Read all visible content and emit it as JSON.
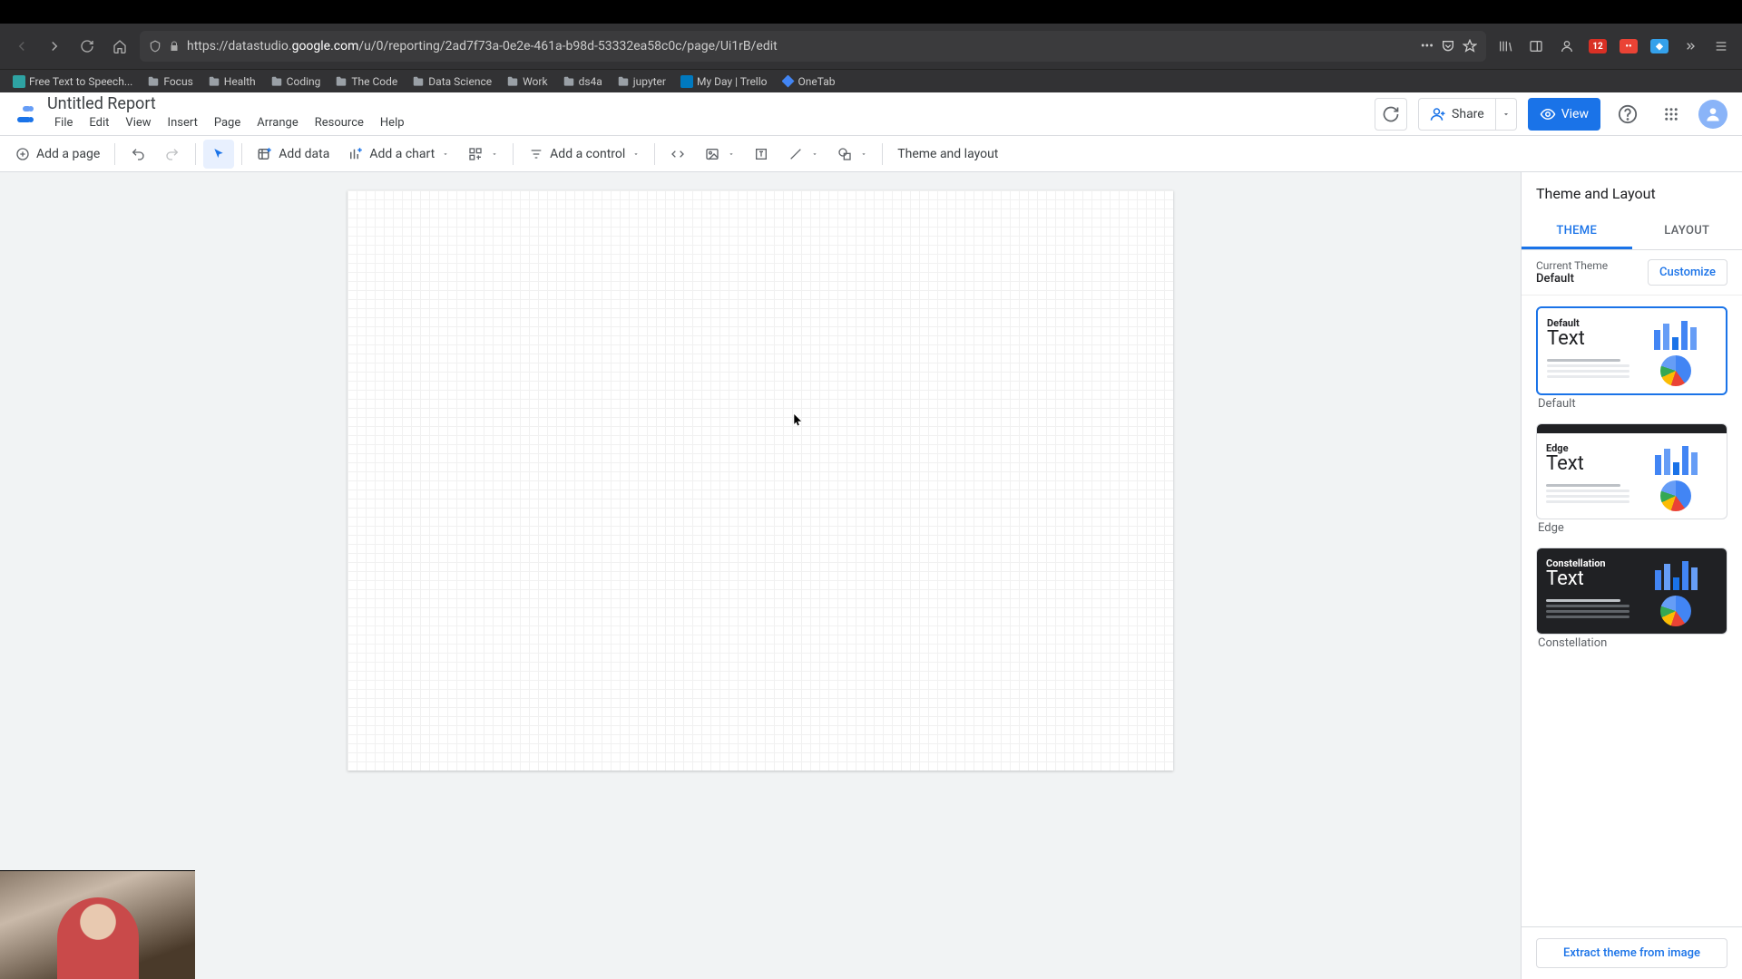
{
  "browser": {
    "url_prefix": "https://datastudio.",
    "url_domain": "google.com",
    "url_suffix": "/u/0/reporting/2ad7f73a-0e2e-461a-b98d-53332ea58c0c/page/Ui1rB/edit",
    "ext_badge1": "12",
    "ext_badge2": "••"
  },
  "bookmarks": [
    {
      "label": "Free Text to Speech...",
      "icon": "app"
    },
    {
      "label": "Focus",
      "icon": "folder"
    },
    {
      "label": "Health",
      "icon": "folder"
    },
    {
      "label": "Coding",
      "icon": "folder"
    },
    {
      "label": "The Code",
      "icon": "folder"
    },
    {
      "label": "Data Science",
      "icon": "folder"
    },
    {
      "label": "Work",
      "icon": "folder"
    },
    {
      "label": "ds4a",
      "icon": "folder"
    },
    {
      "label": "jupyter",
      "icon": "folder"
    },
    {
      "label": "My Day | Trello",
      "icon": "trello"
    },
    {
      "label": "OneTab",
      "icon": "onetab"
    }
  ],
  "report": {
    "title": "Untitled Report"
  },
  "menus": [
    "File",
    "Edit",
    "View",
    "Insert",
    "Page",
    "Arrange",
    "Resource",
    "Help"
  ],
  "header": {
    "share": "Share",
    "view": "View"
  },
  "toolbar": {
    "add_page": "Add a page",
    "add_data": "Add data",
    "add_chart": "Add a chart",
    "add_control": "Add a control",
    "theme_layout": "Theme and layout"
  },
  "sidebar": {
    "title": "Theme and Layout",
    "tab_theme": "THEME",
    "tab_layout": "LAYOUT",
    "current_theme_label": "Current Theme",
    "current_theme_value": "Default",
    "customize": "Customize",
    "themes": [
      {
        "name": "Default",
        "label": "Default",
        "text": "Text",
        "dark": false,
        "selected": true,
        "edge": false
      },
      {
        "name": "Edge",
        "label": "Edge",
        "text": "Text",
        "dark": false,
        "selected": false,
        "edge": true
      },
      {
        "name": "Constellation",
        "label": "Constellation",
        "text": "Text",
        "dark": true,
        "selected": false,
        "edge": false
      }
    ],
    "extract": "Extract theme from image"
  }
}
